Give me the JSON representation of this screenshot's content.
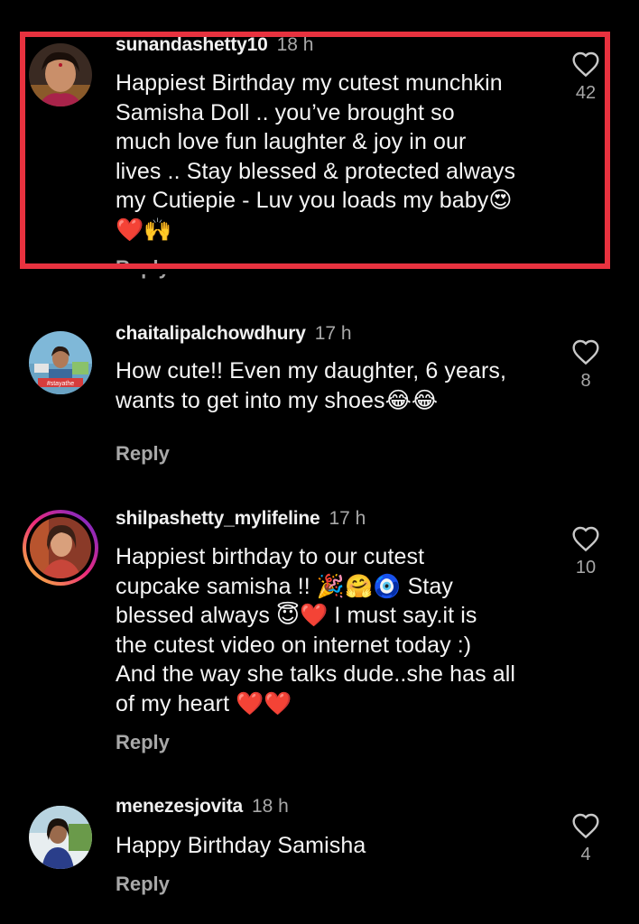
{
  "comments": [
    {
      "username": "sunandashetty10",
      "time": "18 h",
      "text": "Happiest Birthday my cutest munchkin\nSamisha Doll .. you’ve brought so\nmuch love fun laughter & joy in our\nlives .. Stay blessed & protected always\nmy Cutiepie - Luv you loads my baby😍\n❤️🙌",
      "likes": "42",
      "reply_label": "Reply"
    },
    {
      "username": "chaitalipalchowdhury",
      "time": "17 h",
      "text": "How cute!! Even my daughter, 6 years,\nwants to get into my shoes😂😂",
      "likes": "8",
      "reply_label": "Reply"
    },
    {
      "username": "shilpashetty_mylifeline",
      "time": "17 h",
      "text": "Happiest birthday to our cutest\ncupcake samisha !! 🎉🤗🧿 Stay\nblessed always 😇❤️ I must say.it is\nthe cutest video on internet today :)\nAnd the way she talks dude..she has all\nof my heart ❤️❤️",
      "likes": "10",
      "reply_label": "Reply"
    },
    {
      "username": "menezesjovita",
      "time": "18 h",
      "text": "Happy Birthday Samisha",
      "likes": "4",
      "reply_label": "Reply"
    }
  ],
  "colors": {
    "background": "#000000",
    "highlight_border": "#e8323f",
    "secondary_text": "#a8a8a8",
    "story_ring_start": "#f9ce34",
    "story_ring_mid": "#ee2a7b",
    "story_ring_end": "#6228d7"
  },
  "icons": {
    "like": "heart-outline-icon"
  }
}
